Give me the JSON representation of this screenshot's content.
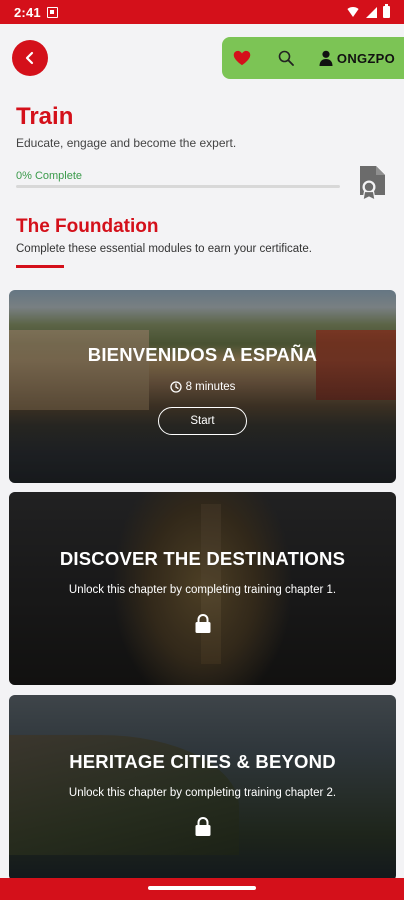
{
  "status_bar": {
    "time": "2:41"
  },
  "header": {
    "user_label": "ONGZPO"
  },
  "train": {
    "title": "Train",
    "subtitle": "Educate, engage and become the expert.",
    "progress_label": "0% Complete",
    "progress_fraction": 0
  },
  "foundation": {
    "title": "The Foundation",
    "subtitle": "Complete these essential modules to earn your certificate."
  },
  "modules": [
    {
      "title": "BIENVENIDOS A ESPAÑA",
      "duration": "8 minutes",
      "button": "Start"
    },
    {
      "title": "DISCOVER THE DESTINATIONS",
      "note": "Unlock this chapter by completing training chapter 1."
    },
    {
      "title": "HERITAGE CITIES & BEYOND",
      "note": "Unlock this chapter by completing training chapter 2."
    }
  ],
  "colors": {
    "brand_red": "#d4101a",
    "accent_green": "#7cc455",
    "progress_green": "#3a9a4a"
  },
  "icons": [
    "back-arrow-icon",
    "heart-icon",
    "search-icon",
    "user-icon",
    "certificate-icon",
    "clock-icon",
    "lock-icon"
  ]
}
